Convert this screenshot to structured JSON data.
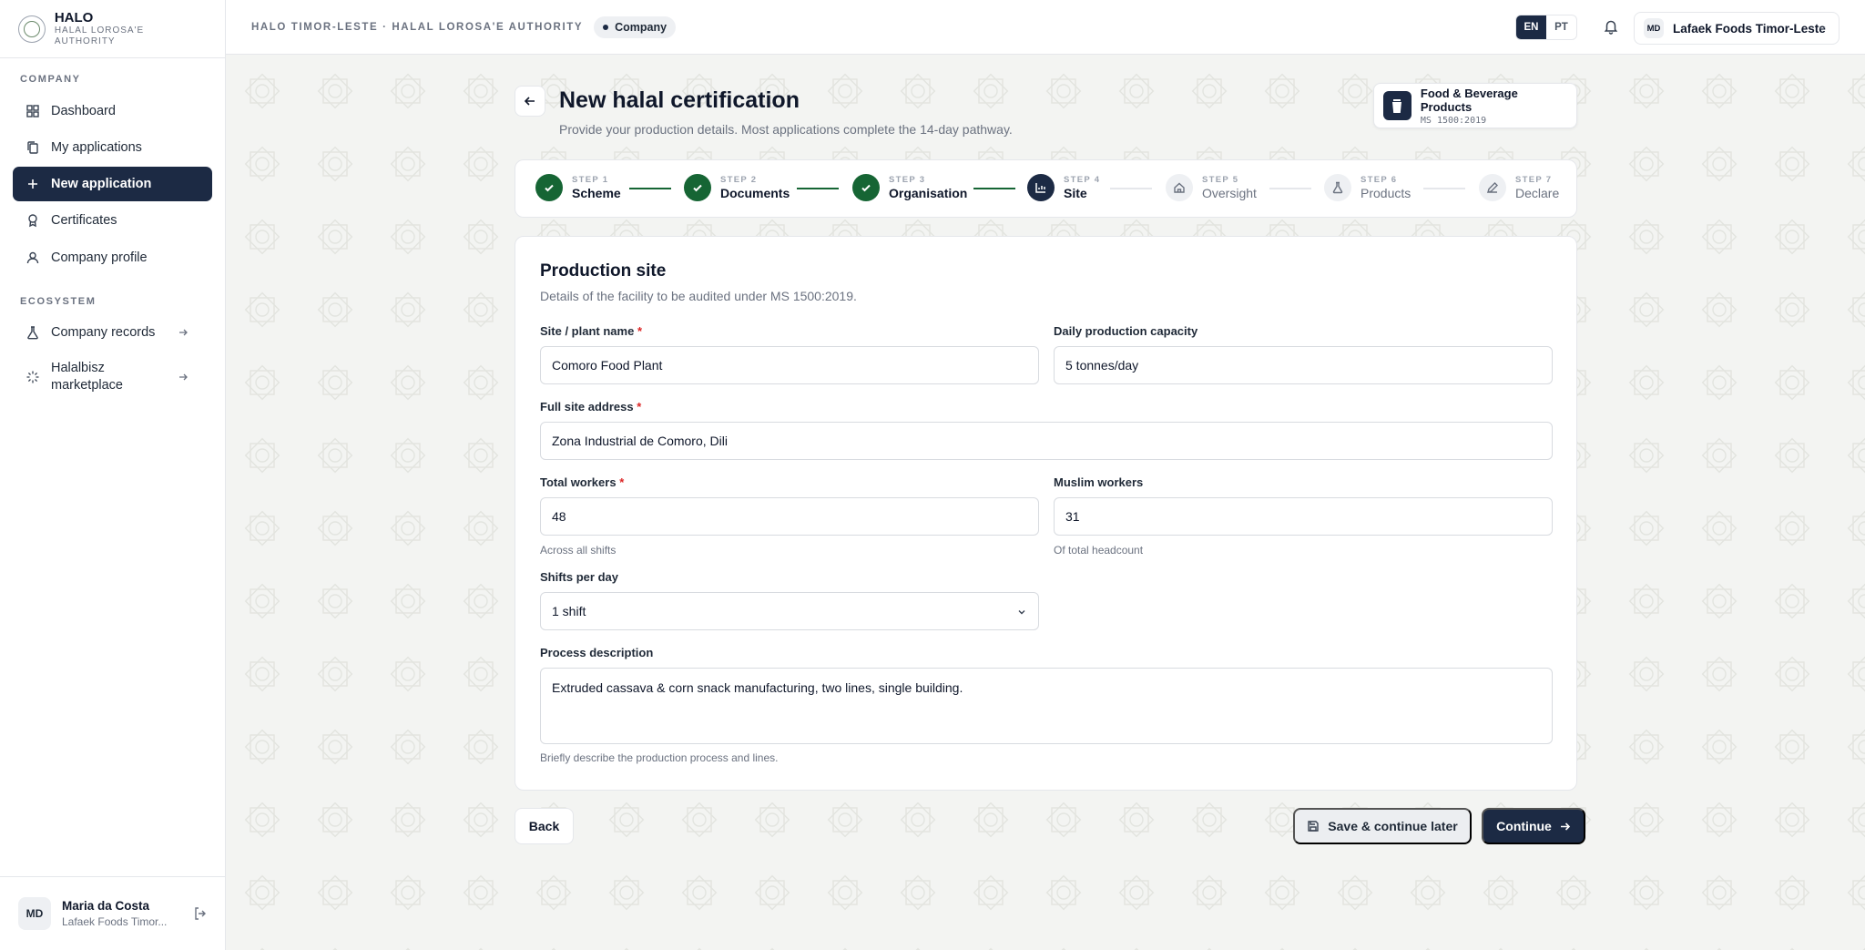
{
  "brand": {
    "name": "HALO",
    "subtitle": "HALAL LOROSA'E AUTHORITY"
  },
  "sidebar": {
    "sections": [
      {
        "label": "COMPANY"
      },
      {
        "label": "ECOSYSTEM"
      }
    ],
    "items": [
      {
        "label": "Dashboard",
        "icon": "grid-icon"
      },
      {
        "label": "My applications",
        "icon": "copy-icon"
      },
      {
        "label": "New application",
        "icon": "plus-icon",
        "active": true
      },
      {
        "label": "Certificates",
        "icon": "award-icon"
      },
      {
        "label": "Company profile",
        "icon": "user-icon"
      },
      {
        "label": "Company records",
        "icon": "flask-icon",
        "external": true
      },
      {
        "label": "Halalbisz marketplace",
        "icon": "sparkle-icon",
        "external": true
      }
    ],
    "user": {
      "initials": "MD",
      "name": "Maria da Costa",
      "org": "Lafaek Foods Timor..."
    }
  },
  "header": {
    "breadcrumb": "HALO TIMOR-LESTE · HALAL LOROSA'E AUTHORITY",
    "role": "Company",
    "languages": [
      "EN",
      "PT"
    ],
    "active_language": "EN",
    "org": {
      "initials": "MD",
      "name": "Lafaek Foods Timor-Leste"
    }
  },
  "page": {
    "title": "New halal certification",
    "subtitle": "Provide your production details. Most applications complete the 14-day pathway.",
    "scheme": {
      "name": "Food & Beverage Products",
      "standard": "MS 1500:2019"
    }
  },
  "steps": [
    {
      "num": "STEP 1",
      "label": "Scheme",
      "state": "done"
    },
    {
      "num": "STEP 2",
      "label": "Documents",
      "state": "done"
    },
    {
      "num": "STEP 3",
      "label": "Organisation",
      "state": "done"
    },
    {
      "num": "STEP 4",
      "label": "Site",
      "state": "current"
    },
    {
      "num": "STEP 5",
      "label": "Oversight",
      "state": "todo"
    },
    {
      "num": "STEP 6",
      "label": "Products",
      "state": "todo"
    },
    {
      "num": "STEP 7",
      "label": "Declare",
      "state": "todo"
    }
  ],
  "form": {
    "title": "Production site",
    "subtitle": "Details of the facility to be audited under MS 1500:2019.",
    "site_name": {
      "label": "Site / plant name",
      "value": "Comoro Food Plant"
    },
    "capacity": {
      "label": "Daily production capacity",
      "value": "5 tonnes/day"
    },
    "address": {
      "label": "Full site address",
      "value": "Zona Industrial de Comoro, Dili"
    },
    "total_workers": {
      "label": "Total workers",
      "value": "48",
      "help": "Across all shifts"
    },
    "muslim_workers": {
      "label": "Muslim workers",
      "value": "31",
      "help": "Of total headcount"
    },
    "shifts": {
      "label": "Shifts per day",
      "value": "1 shift"
    },
    "process": {
      "label": "Process description",
      "value": "Extruded cassava & corn snack manufacturing, two lines, single building.",
      "help": "Briefly describe the production process and lines."
    }
  },
  "actions": {
    "back": "Back",
    "save": "Save & continue later",
    "continue": "Continue"
  },
  "colors": {
    "navy": "#1c2a44",
    "done_green": "#166534",
    "required": "#dc2626"
  }
}
